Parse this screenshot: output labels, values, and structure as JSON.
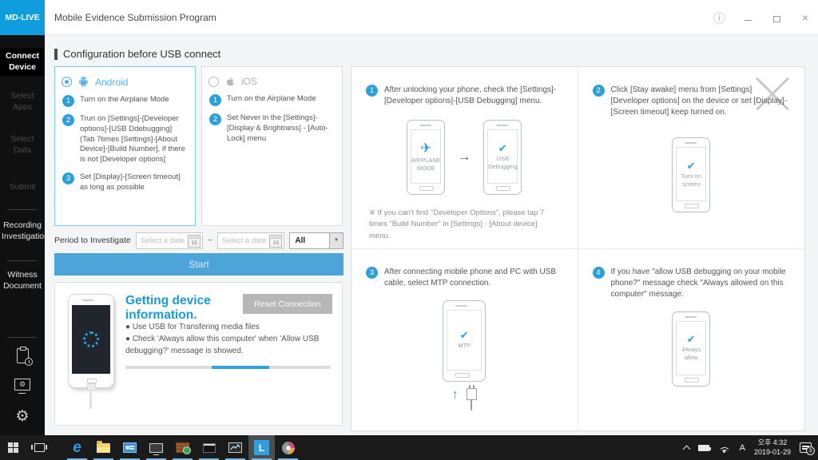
{
  "window": {
    "logo": "MD-LIVE",
    "title": "Mobile Evidence Submission Program"
  },
  "sidebar": {
    "items": [
      {
        "label": "Connect Device"
      },
      {
        "label": "Select Apps"
      },
      {
        "label": "Select Data"
      },
      {
        "label": "Submit"
      },
      {
        "label": "Recording Investigation"
      },
      {
        "label": "Witness Document"
      }
    ]
  },
  "config": {
    "heading": "Configuration before USB connect",
    "android": {
      "label": "Android",
      "steps": [
        {
          "num": "1",
          "text": "Turn on the Airplane Mode"
        },
        {
          "num": "2",
          "text": "Trun on [Settings]-[Developer options]-[USB Ddebugging]\n(Tab 7times [Settings]-[About Device]-[Build Number], if there is not [Developer options]"
        },
        {
          "num": "3",
          "text": "Set [Display]-[Screen timeout] as long as possible"
        }
      ]
    },
    "ios": {
      "label": "iOS",
      "steps": [
        {
          "num": "1",
          "text": "Turn on the Airplane Mode"
        },
        {
          "num": "2",
          "text": "Set Never in the [Settings]-[Display & Brightness] - [Auto-Lock] menu"
        }
      ]
    },
    "period": {
      "label": "Period to Investigate",
      "date_placeholder": "Select a date",
      "calendar_day": "15",
      "separator": "~",
      "filter_value": "All"
    },
    "start_label": "Start",
    "device_info": {
      "title": "Getting device information.",
      "reset_label": "Reset Connection",
      "bullets": [
        "● Use USB for Transfering media files",
        "● Check 'Always allow this computer' when 'Allow USB debugging?' message is showed."
      ],
      "progress_percent": 28
    }
  },
  "guide": {
    "steps": [
      {
        "num": "1",
        "text": "After unlocking your phone, check the [Settings]-[Developer options]-[USB Debugging] menu.",
        "phone1_label": "AIRPLANE\nMODE",
        "phone2_label": "USB\nDebugging",
        "note": "※ If you can't find \"Developer Options\", please tap 7 times \"Build Number\" in [Settings] - [About device] menu."
      },
      {
        "num": "2",
        "text": "Click [Stay awake] menu from [Settings][Developer options] on the device or set [Display]-[Screen timeout] keep turned on.",
        "phone_label": "Turn on\nscreen"
      },
      {
        "num": "3",
        "text": "After connecting mobile phone and PC with USB cable, select MTP connection.",
        "phone_label": "MTP"
      },
      {
        "num": "4",
        "text": "If you have \"allow USB debugging on your mobile phone?\" message check \"Always allowed on this computer\" message.",
        "phone_label": "Always\nallow"
      }
    ]
  },
  "taskbar": {
    "tray": {
      "ime": "A",
      "time": "오후 4:32",
      "date": "2019-01-29",
      "notification_count": "3"
    }
  },
  "icons": {
    "check": "✔",
    "airplane": "✈",
    "arrow_right": "→",
    "arrow_up": "↑",
    "dropdown_arrow": "▼",
    "info": "ⓘ",
    "close": "×",
    "gear": "⚙",
    "edge_logo": "e",
    "mdlive_tile": "L"
  },
  "colors": {
    "brand_blue": "#0f9ddd",
    "accent_blue": "#2d9fd9",
    "start_button_blue": "#4ca4d9"
  }
}
